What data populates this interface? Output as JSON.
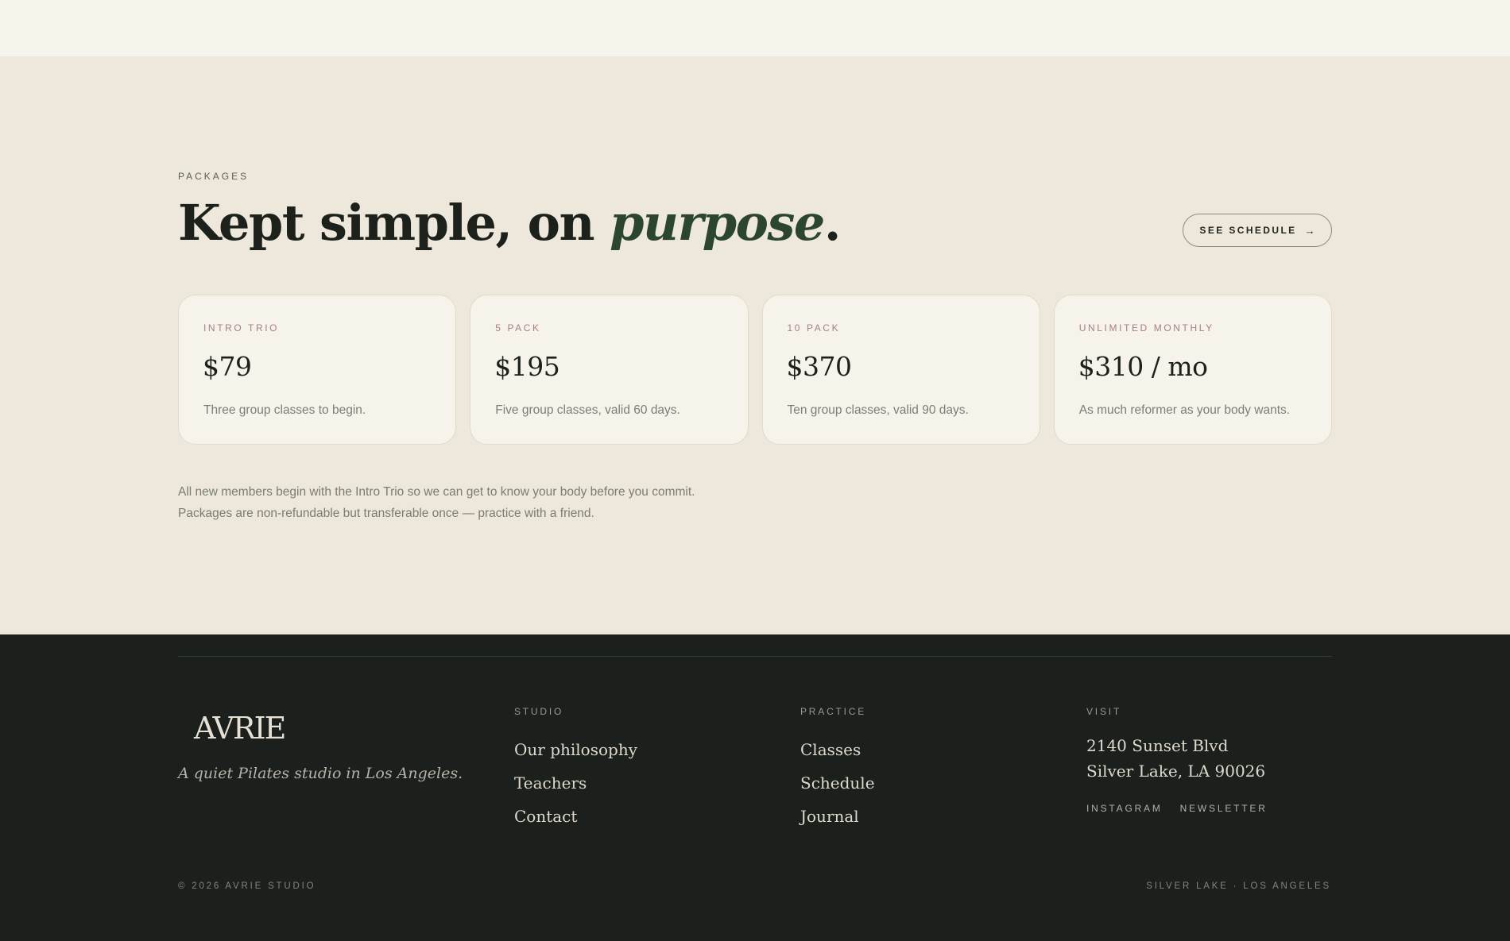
{
  "packages": {
    "eyebrow": "PACKAGES",
    "headline_start": "Kept simple, on ",
    "headline_emphasis": "purpose",
    "headline_end": ".",
    "schedule_button": {
      "label": "SEE SCHEDULE",
      "icon": "arrow-right-icon"
    },
    "cards": [
      {
        "label": "INTRO TRIO",
        "price": "$79",
        "description": "Three group classes to begin."
      },
      {
        "label": "5 PACK",
        "price": "$195",
        "description": "Five group classes, valid 60 days."
      },
      {
        "label": "10 PACK",
        "price": "$370",
        "description": "Ten group classes, valid 90 days."
      },
      {
        "label": "UNLIMITED MONTHLY",
        "price": "$310 / mo",
        "description": "As much reformer as your body wants."
      }
    ],
    "note_line1": "All new members begin with the Intro Trio so we can get to know your body before you commit.",
    "note_line2": "Packages are non-refundable but transferable once — practice with a friend."
  },
  "footer": {
    "logo": "AVRIE",
    "tagline": "A quiet Pilates studio in Los Angeles.",
    "studio": {
      "title": "STUDIO",
      "links": [
        "Our philosophy",
        "Teachers",
        "Contact"
      ]
    },
    "practice": {
      "title": "PRACTICE",
      "links": [
        "Classes",
        "Schedule",
        "Journal"
      ]
    },
    "visit": {
      "title": "VISIT",
      "address_line1": "2140 Sunset Blvd",
      "address_line2": "Silver Lake, LA 90026",
      "social": [
        "INSTAGRAM",
        "NEWSLETTER"
      ]
    },
    "copyright": "© 2026 AVRIE STUDIO",
    "location": "SILVER LAKE · LOS ANGELES"
  },
  "colors": {
    "background_top": "#f6f3eb",
    "background_packages": "#eee8dc",
    "card_bg": "#f6f3eb",
    "accent_green": "#2c4530",
    "label_rose": "#a67e85",
    "footer_bg": "#1b201c"
  }
}
